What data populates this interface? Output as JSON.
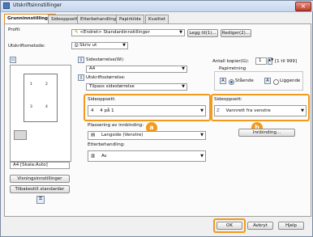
{
  "window": {
    "title": "Utskriftsinnstillinger"
  },
  "tabs": [
    "Grunninnstillinger",
    "Sideoppsett",
    "Etterbehandling",
    "Papirkilde",
    "Kvalitet"
  ],
  "profile": {
    "label": "Profil:",
    "value": "<Endret> Standardinnstillinger",
    "add_label": "Legg til(1)...",
    "edit_label": "Rediger(2)..."
  },
  "output": {
    "label": "Utskriftsmetode:",
    "value": "Skriv ut"
  },
  "page_size": {
    "label": "Sidestørrelse(W):",
    "value": "A4"
  },
  "output_size": {
    "label": "Utskriftsstørrelse:",
    "value": "Tilpass sidestørrelse"
  },
  "copies": {
    "label": "Antall kopier(G):",
    "value": "1",
    "range": "[1 til 999]"
  },
  "orientation": {
    "group_label": "Papirretning",
    "portrait": "Stående",
    "landscape": "Liggende"
  },
  "page_layout": {
    "label": "Sideoppsett:",
    "value": "4 på 1",
    "icon_text": "4"
  },
  "binding_order": {
    "label": "Sideoppsett:",
    "value": "Vannrett fra venstre"
  },
  "placement": {
    "label": "Plassering av innbinding:",
    "value": "Langside (Venstre)"
  },
  "finishing": {
    "label": "Etterbehandling:",
    "value": "Av"
  },
  "gutter_button": "Innbinding...",
  "preview": {
    "status": "A4 [Skala:Auto]",
    "cells": [
      "1",
      "2",
      "3",
      "4"
    ]
  },
  "buttons": {
    "view_settings": "Visningsinnstillinger",
    "restore_defaults": "Tilbakestill standarder",
    "ok": "OK",
    "cancel": "Avbryt",
    "help": "Hjelp"
  },
  "callouts": {
    "a": "a",
    "b": "b"
  }
}
